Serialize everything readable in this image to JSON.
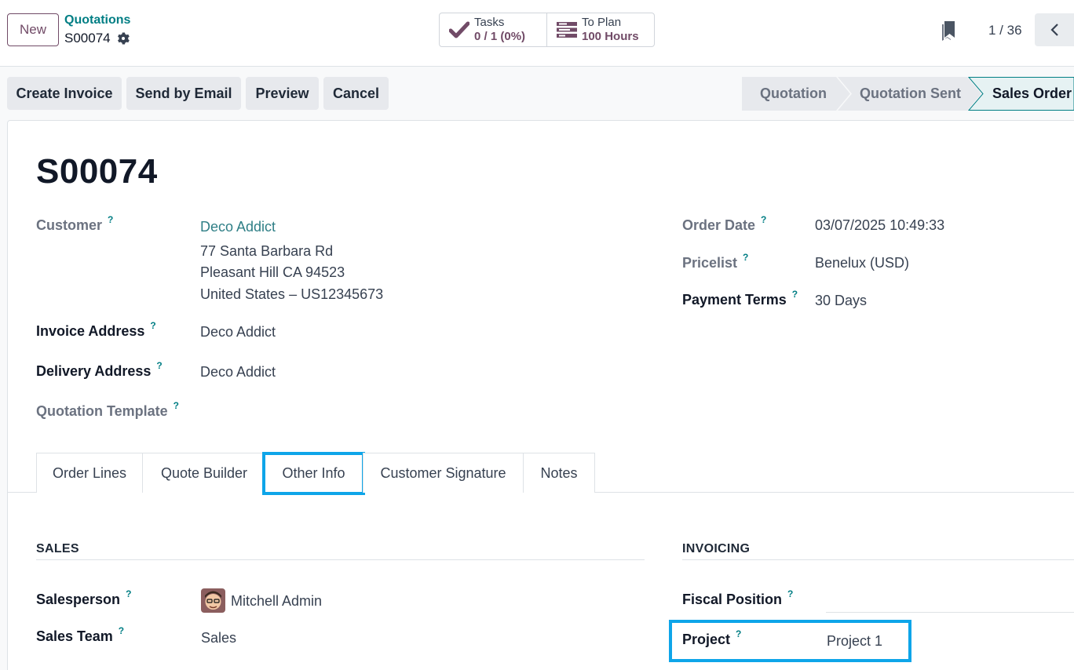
{
  "header": {
    "new_label": "New",
    "breadcrumb_parent": "Quotations",
    "breadcrumb_current": "S00074",
    "stats": {
      "tasks_label": "Tasks",
      "tasks_value": "0 / 1 (0%)",
      "plan_label": "To Plan",
      "plan_value": "100 Hours"
    },
    "pager": "1 / 36"
  },
  "actions": {
    "create_invoice": "Create Invoice",
    "send_email": "Send by Email",
    "preview": "Preview",
    "cancel": "Cancel"
  },
  "status": {
    "steps": [
      "Quotation",
      "Quotation Sent",
      "Sales Order"
    ],
    "active": "Sales Order"
  },
  "form": {
    "title": "S00074",
    "customer_label": "Customer",
    "customer_name": "Deco Addict",
    "customer_addr1": "77 Santa Barbara Rd",
    "customer_addr2": "Pleasant Hill CA 94523",
    "customer_addr3": "United States – US12345673",
    "invoice_address_label": "Invoice Address",
    "invoice_address": "Deco Addict",
    "delivery_address_label": "Delivery Address",
    "delivery_address": "Deco Addict",
    "quotation_template_label": "Quotation Template",
    "order_date_label": "Order Date",
    "order_date": "03/07/2025 10:49:33",
    "pricelist_label": "Pricelist",
    "pricelist": "Benelux (USD)",
    "payment_terms_label": "Payment Terms",
    "payment_terms": "30 Days",
    "help_mark": "?"
  },
  "tabs": [
    "Order Lines",
    "Quote Builder",
    "Other Info",
    "Customer Signature",
    "Notes"
  ],
  "other_info": {
    "sales_title": "SALES",
    "invoicing_title": "INVOICING",
    "salesperson_label": "Salesperson",
    "salesperson": "Mitchell Admin",
    "sales_team_label": "Sales Team",
    "sales_team": "Sales",
    "fiscal_position_label": "Fiscal Position",
    "project_label": "Project",
    "project": "Project 1"
  },
  "colors": {
    "brand": "#714b67",
    "link": "#017e84",
    "highlight": "#0ea5e9"
  }
}
